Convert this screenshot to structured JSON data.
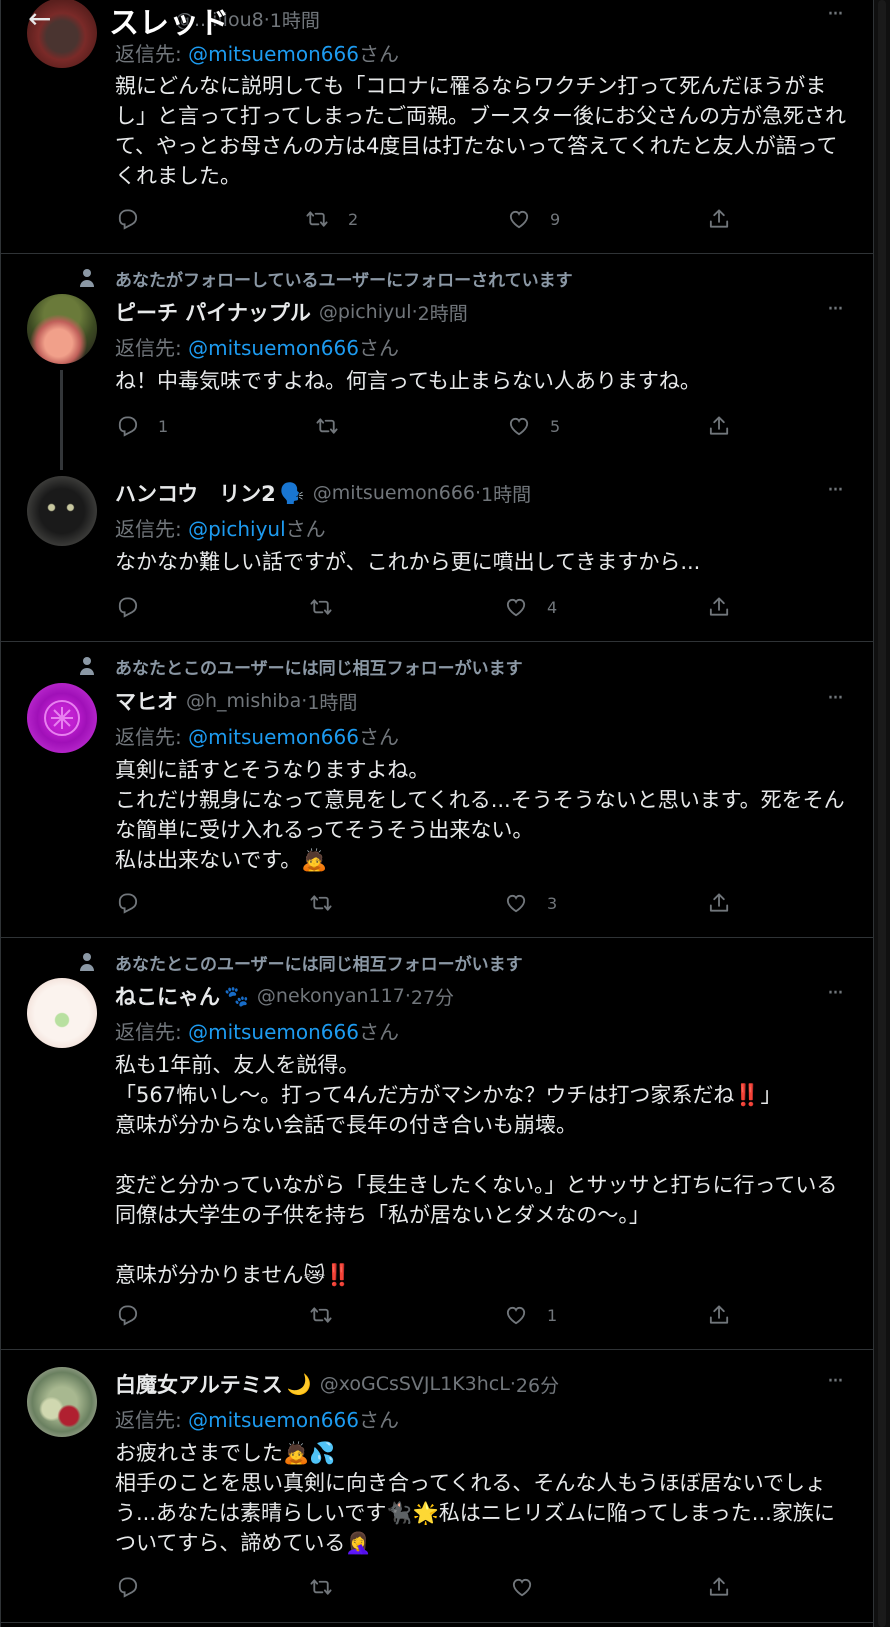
{
  "topbar": {
    "title": "スレッド",
    "back_glyph": "←"
  },
  "tweets": [
    {
      "name": "",
      "handle": "@...illou8",
      "time": "1時間",
      "dot": " · ",
      "reply_prefix": "返信先: ",
      "reply_to": "@mitsuemon666",
      "reply_suffix": "さん",
      "body": "親にどんなに説明しても「コロナに罹るならワクチン打って死んだほうがまし」と言って打ってしまったご両親。ブースター後にお父さんの方が急死されて、やっとお母さんの方は4度目は打たないって答えてくれたと友人が語ってくれました。",
      "counts": {
        "reply": "",
        "retweet": "2",
        "like": "9"
      }
    },
    {
      "social": "あなたがフォローしているユーザーにフォローされています",
      "name": "ピーチ パイナップル",
      "handle": "@pichiyul",
      "time": "2時間",
      "dot": " · ",
      "reply_prefix": "返信先: ",
      "reply_to": "@mitsuemon666",
      "reply_suffix": "さん",
      "body": "ね！中毒気味ですよね。何言っても止まらない人ありますね。",
      "counts": {
        "reply": "1",
        "retweet": "",
        "like": "5"
      }
    },
    {
      "name": "ハンコウ　リン2",
      "emoji": "🗣️",
      "handle": "@mitsuemon666",
      "time": "1時間",
      "dot": " · ",
      "reply_prefix": "返信先: ",
      "reply_to": "@pichiyul",
      "reply_suffix": "さん",
      "body": "なかなか難しい話ですが、これから更に噴出してきますから...",
      "counts": {
        "reply": "",
        "retweet": "",
        "like": "4"
      }
    },
    {
      "social": "あなたとこのユーザーには同じ相互フォローがいます",
      "name": "マヒオ",
      "handle": "@h_mishiba",
      "time": "1時間",
      "dot": " · ",
      "reply_prefix": "返信先: ",
      "reply_to": "@mitsuemon666",
      "reply_suffix": "さん",
      "body": "真剣に話すとそうなりますよね。\nこれだけ親身になって意見をしてくれる...そうそうないと思います。死をそんな簡単に受け入れるってそうそう出来ない。\n私は出来ないです。🙇",
      "counts": {
        "reply": "",
        "retweet": "",
        "like": "3"
      }
    },
    {
      "social": "あなたとこのユーザーには同じ相互フォローがいます",
      "name": "ねこにゃん",
      "emoji": "🐾",
      "handle": "@nekonyan117",
      "time": "27分",
      "dot": " · ",
      "reply_prefix": "返信先: ",
      "reply_to": "@mitsuemon666",
      "reply_suffix": "さん",
      "body": "私も1年前、友人を説得。\n「567怖いし〜。打って4んだ方がマシかな？ウチは打つ家系だね‼️」\n意味が分からない会話で長年の付き合いも崩壊。\n\n変だと分かっていながら「長生きしたくない。」とサッサと打ちに行っている同僚は大学生の子供を持ち「私が居ないとダメなの〜。」\n\n意味が分かりません😿‼️",
      "counts": {
        "reply": "",
        "retweet": "",
        "like": "1"
      }
    },
    {
      "name": "白魔女アルテミス",
      "emoji": "🌙",
      "handle": "@xoGCsSVJL1K3hcL",
      "time": "26分",
      "dot": " · ",
      "reply_prefix": "返信先: ",
      "reply_to": "@mitsuemon666",
      "reply_suffix": "さん",
      "body": "お疲れさまでした🙇💦\n相手のことを思い真剣に向き合ってくれる、そんな人もうほぼ居ないでしょう...あなたは素晴らしいです🐈‍⬛🌟私はニヒリズムに陥ってしまった...家族についてすら、諦めている🤦‍♀️",
      "counts": {
        "reply": "",
        "retweet": "",
        "like": ""
      }
    }
  ],
  "icons": {
    "reply": "reply-icon",
    "retweet": "retweet-icon",
    "like": "like-icon",
    "share": "share-icon",
    "more": "more-icon",
    "person": "person-icon"
  },
  "colors": {
    "background": "#000000",
    "text": "#e7e9ea",
    "muted": "#71767b",
    "mention": "#1d9bf0",
    "border": "#2f3336"
  }
}
